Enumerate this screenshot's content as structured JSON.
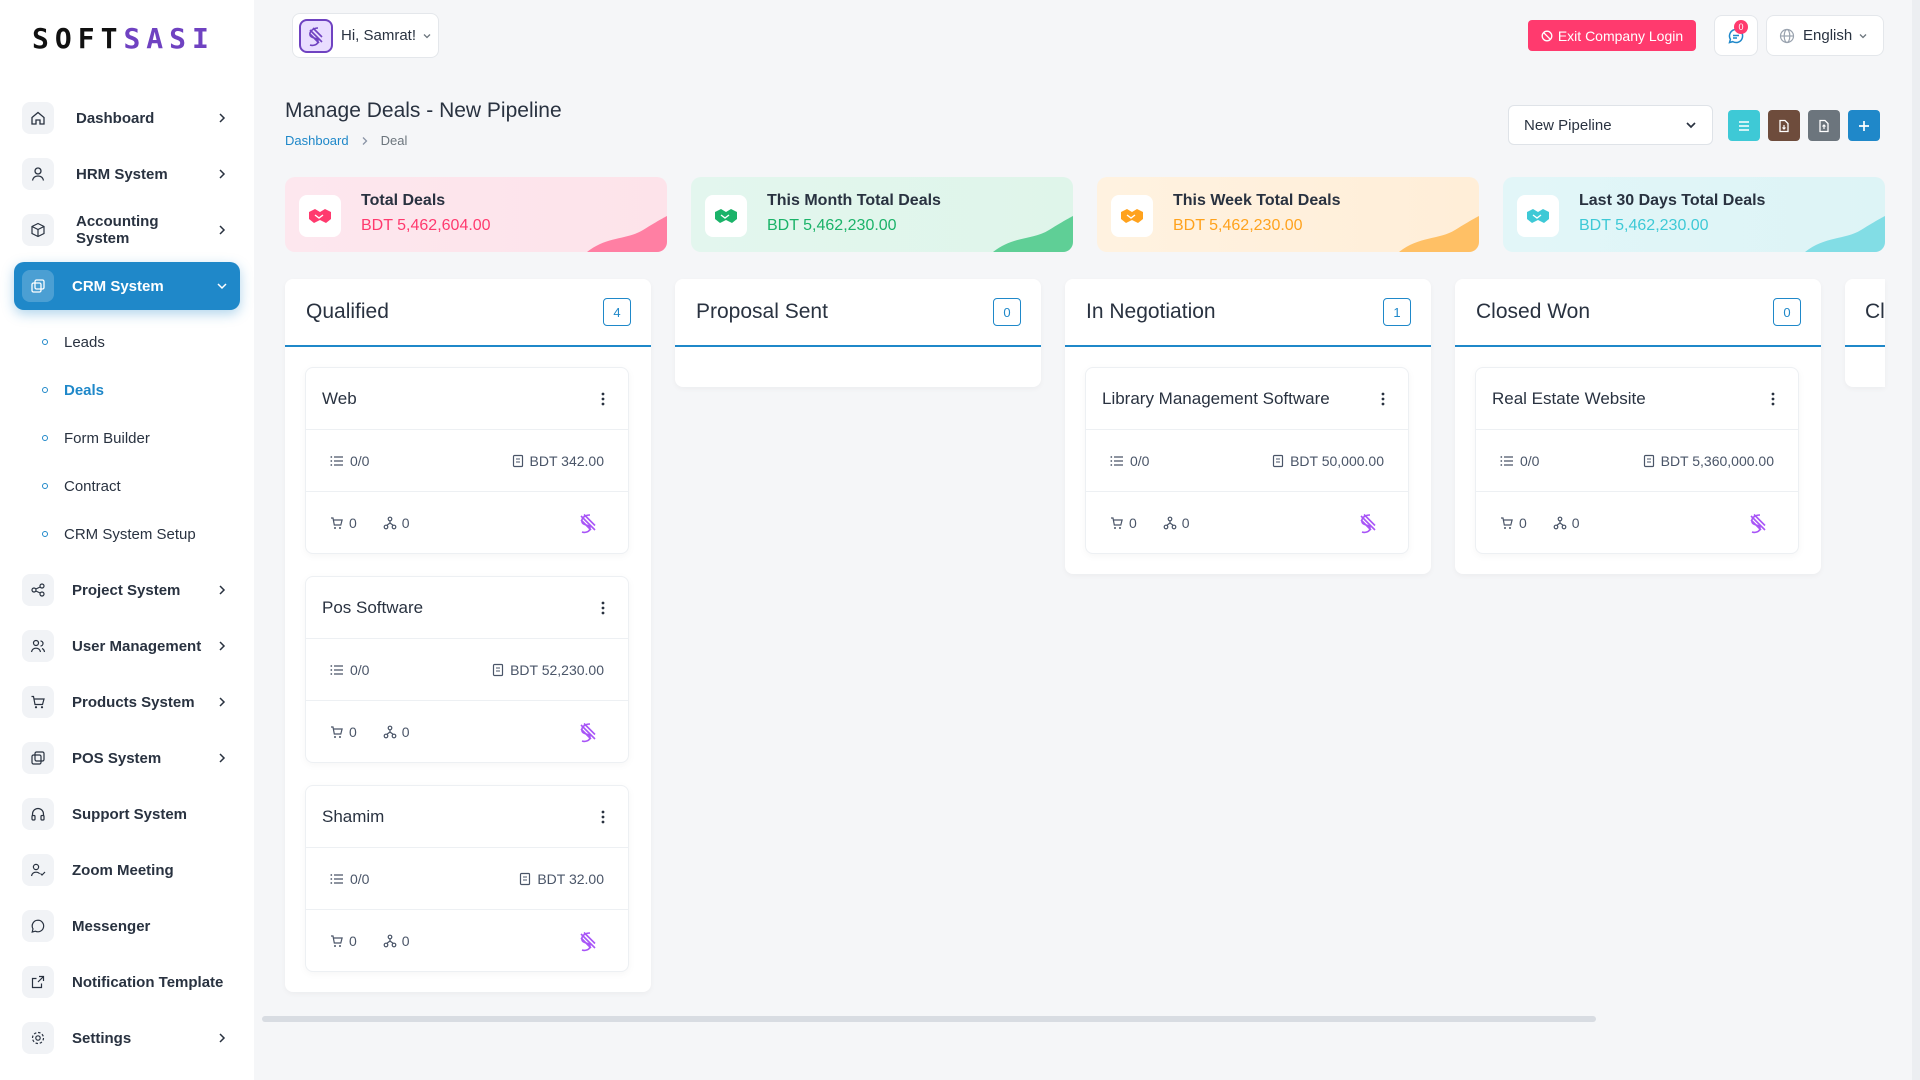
{
  "brand": {
    "logo_part1": "SOFT",
    "logo_part2": "SASI"
  },
  "header": {
    "greeting": "Hi, Samrat!",
    "exit_label": "Exit Company Login",
    "notification_count": "0",
    "language": "English"
  },
  "sidebar": {
    "items": [
      {
        "label": "Dashboard"
      },
      {
        "label": "HRM System"
      },
      {
        "label": "Accounting System"
      },
      {
        "label": "CRM System"
      },
      {
        "label": "Project System"
      },
      {
        "label": "User Management"
      },
      {
        "label": "Products System"
      },
      {
        "label": "POS System"
      },
      {
        "label": "Support System"
      },
      {
        "label": "Zoom Meeting"
      },
      {
        "label": "Messenger"
      },
      {
        "label": "Notification Template"
      },
      {
        "label": "Settings"
      }
    ],
    "crm_sub": [
      {
        "label": "Leads"
      },
      {
        "label": "Deals"
      },
      {
        "label": "Form Builder"
      },
      {
        "label": "Contract"
      },
      {
        "label": "CRM System Setup"
      }
    ]
  },
  "page": {
    "title": "Manage Deals - New Pipeline",
    "breadcrumb": {
      "home": "Dashboard",
      "current": "Deal"
    },
    "pipeline_select": "New Pipeline"
  },
  "stats": [
    {
      "title": "Total Deals",
      "value": "BDT 5,462,604.00",
      "color": "#ff3a6e"
    },
    {
      "title": "This Month Total Deals",
      "value": "BDT 5,462,230.00",
      "color": "#1bb369"
    },
    {
      "title": "This Week Total Deals",
      "value": "BDT 5,462,230.00",
      "color": "#ffa21d"
    },
    {
      "title": "Last 30 Days Total Deals",
      "value": "BDT 5,462,230.00",
      "color": "#3ec9d6"
    }
  ],
  "columns": [
    {
      "title": "Qualified",
      "count": "4",
      "cards": [
        {
          "name": "Web",
          "tasks": "0/0",
          "amount": "BDT 342.00",
          "products": "0",
          "sources": "0"
        },
        {
          "name": "Pos Software",
          "tasks": "0/0",
          "amount": "BDT 52,230.00",
          "products": "0",
          "sources": "0"
        },
        {
          "name": "Shamim",
          "tasks": "0/0",
          "amount": "BDT 32.00",
          "products": "0",
          "sources": "0"
        }
      ]
    },
    {
      "title": "Proposal Sent",
      "count": "0",
      "cards": []
    },
    {
      "title": "In Negotiation",
      "count": "1",
      "cards": [
        {
          "name": "Library Management Software",
          "tasks": "0/0",
          "amount": "BDT 50,000.00",
          "products": "0",
          "sources": "0"
        }
      ]
    },
    {
      "title": "Closed Won",
      "count": "0",
      "cards": [
        {
          "name": "Real Estate Website",
          "tasks": "0/0",
          "amount": "BDT 5,360,000.00",
          "products": "0",
          "sources": "0"
        }
      ]
    },
    {
      "title": "Cl",
      "count": "",
      "cards": []
    }
  ],
  "colors": {
    "primary": "#1f88c9",
    "danger": "#ff3a6e",
    "brand_purple": "#6f42c1"
  }
}
